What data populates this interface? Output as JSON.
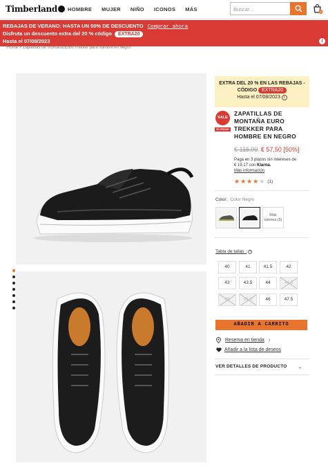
{
  "header": {
    "logo": "Timberland",
    "nav": [
      "HOMBRE",
      "MUJER",
      "NIÑO",
      "ICONOS",
      "MÁS"
    ],
    "search_placeholder": "Buscar...",
    "cart_count": "0"
  },
  "promo": {
    "line1": "REBAJAS DE VERANO: HASTA UN 50% DE DESCUENTO",
    "line1_link": "Comprar ahora",
    "line2": "Disfruta un descuento extra del 20 % código",
    "line2_code": "EXTRA20",
    "line3": "Hasta el 07/08/2023"
  },
  "breadcrumb": "Home > Zapatillas de montaña Euro Trekker para hombre en negro",
  "promo_box": {
    "line1": "EXTRA DEL 20 % EN LAS REBAJAS -",
    "line2_prefix": "CÓDIGO",
    "code": "EXTRA20",
    "until": "Hasta el 07/08/2023"
  },
  "badges": {
    "sale": "SALE",
    "extra": "EXTRA20"
  },
  "product": {
    "title": "ZAPATILLAS DE MONTAÑA EURO TREKKER PARA HOMBRE EN NEGRO",
    "old_price": "€ 115,00",
    "new_price": "€ 57,50 [50%]",
    "klarna_line1": "Paga en 3 plazos sin intereses de",
    "klarna_amount": "€ 19.17 con",
    "klarna_brand": "Klarna.",
    "klarna_more": "Más información",
    "rating": 4,
    "rating_count": "(1)"
  },
  "color": {
    "label": "Color:",
    "value": "Color Negro",
    "more": "Más colores (5)"
  },
  "sizes": {
    "label": "Tabla de tallas",
    "items": [
      {
        "label": "40",
        "available": true
      },
      {
        "label": "41",
        "available": true
      },
      {
        "label": "41.5",
        "available": true
      },
      {
        "label": "42",
        "available": true
      },
      {
        "label": "43",
        "available": true
      },
      {
        "label": "43.5",
        "available": true
      },
      {
        "label": "44",
        "available": true
      },
      {
        "label": "44.5",
        "available": false
      },
      {
        "label": "45",
        "available": false
      },
      {
        "label": "45.5",
        "available": false
      },
      {
        "label": "46",
        "available": true
      },
      {
        "label": "47.5",
        "available": true
      }
    ]
  },
  "actions": {
    "add_to_cart": "AÑADIR A CARRITO",
    "reserve": "Reserva en tienda",
    "wishlist": "Añadir a la lista de deseos",
    "details": "VER DETALLES DE PRODUCTO"
  },
  "colors": {
    "accent": "#e8742d",
    "sale_red": "#d93a34",
    "promo_yellow": "#fdf1c4"
  }
}
